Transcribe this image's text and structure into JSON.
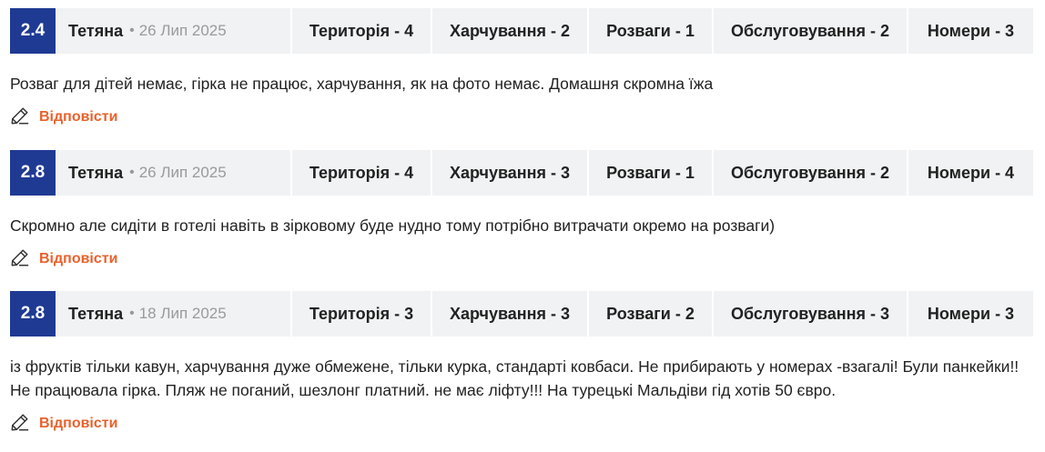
{
  "reviews": [
    {
      "score": "2.4",
      "author": "Тетяна",
      "separator": "•",
      "date": "26 Лип 2025",
      "categories": [
        "Територія - 4",
        "Харчування - 2",
        "Розваги - 1",
        "Обслуговування - 2",
        "Номери - 3"
      ],
      "text": "Розваг для дітей немає, гірка не працює, харчування, як на фото немає. Домашня скромна їжа",
      "reply_label": "Відповісти"
    },
    {
      "score": "2.8",
      "author": "Тетяна",
      "separator": "•",
      "date": "26 Лип 2025",
      "categories": [
        "Територія - 4",
        "Харчування - 3",
        "Розваги - 1",
        "Обслуговування - 2",
        "Номери - 4"
      ],
      "text": "Скромно але сидіти в готелі навіть в зірковому буде нудно тому потрібно витрачати окремо на розваги)",
      "reply_label": "Відповісти"
    },
    {
      "score": "2.8",
      "author": "Тетяна",
      "separator": "•",
      "date": "18 Лип 2025",
      "categories": [
        "Територія - 3",
        "Харчування - 3",
        "Розваги - 2",
        "Обслуговування - 3",
        "Номери - 3"
      ],
      "text": "із фруктів тільки кавун, харчування дуже обмежене, тільки курка, стандарті ковбаси. Не прибирають у номерах -взагалі! Були панкейки!! Не працювала гірка. Пляж не поганий, шезлонг платний. не має ліфту!!! На турецькі Мальдіви гід хотів 50 євро.",
      "reply_label": "Відповісти"
    }
  ],
  "colors": {
    "score_bg": "#1f3a93",
    "header_bg": "#f1f2f3",
    "reply": "#e8612c",
    "date": "#9a9a9a"
  },
  "icons": {
    "reply": "pencil-icon"
  }
}
